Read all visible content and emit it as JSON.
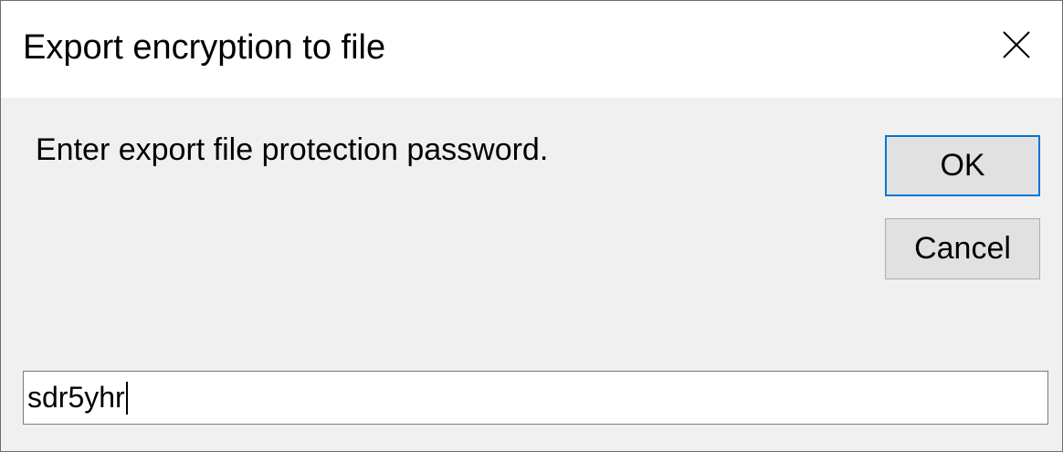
{
  "dialog": {
    "title": "Export encryption to file",
    "close_icon": "close-icon",
    "prompt": "Enter export file protection password.",
    "ok_label": "OK",
    "cancel_label": "Cancel",
    "password_value": "sdr5yhr"
  },
  "colors": {
    "face": "#f0f0f0",
    "titlebar": "#ffffff",
    "button": "#e1e1e1",
    "focus_border": "#0078d7"
  }
}
